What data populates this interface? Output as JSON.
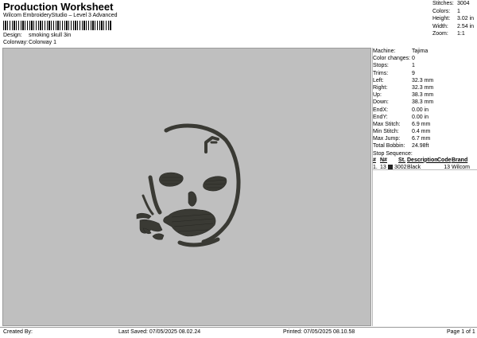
{
  "header": {
    "title": "Production Worksheet",
    "subtitle": "Wilcom EmbroideryStudio – Level 3 Advanced"
  },
  "meta": [
    {
      "key": "Design:",
      "value": "smoking skull 3in"
    },
    {
      "key": "Colorway:",
      "value": "Colorway 1"
    }
  ],
  "stats": [
    {
      "key": "Stitches:",
      "value": "3004"
    },
    {
      "key": "Colors:",
      "value": "1"
    },
    {
      "key": "Height:",
      "value": "3.02 in"
    },
    {
      "key": "Width:",
      "value": "2.54 in"
    },
    {
      "key": "Zoom:",
      "value": "1:1"
    }
  ],
  "info": [
    {
      "key": "Machine:",
      "value": "Tajima"
    },
    {
      "key": "Color changes:",
      "value": "0"
    },
    {
      "key": "Stops:",
      "value": "1"
    },
    {
      "key": "Trims:",
      "value": "9"
    },
    {
      "key": "Left:",
      "value": "32.3 mm"
    },
    {
      "key": "Right:",
      "value": "32.3 mm"
    },
    {
      "key": "Up:",
      "value": "38.3 mm"
    },
    {
      "key": "Down:",
      "value": "38.3 mm"
    },
    {
      "key": "EndX:",
      "value": "0.00 in"
    },
    {
      "key": "EndY:",
      "value": "0.00 in"
    },
    {
      "key": "Max Stitch:",
      "value": "6.9 mm"
    },
    {
      "key": "Min Stitch:",
      "value": "0.4 mm"
    },
    {
      "key": "Max Jump:",
      "value": "6.7 mm"
    },
    {
      "key": "Total Bobbin:",
      "value": "24.98ft"
    }
  ],
  "stop_sequence": {
    "label": "Stop Sequence:",
    "headers": [
      "#",
      "N#",
      "St.",
      "Description",
      "Code",
      "Brand"
    ],
    "rows": [
      {
        "num": "1.",
        "n": "13",
        "st": "3002",
        "desc": "Black",
        "code": "13",
        "brand": "Wilcom",
        "color": "#222222"
      }
    ]
  },
  "footer": {
    "created": "Created By:",
    "saved": "Last Saved: 07/05/2025 08.02.24",
    "printed": "Printed: 07/05/2025 08.10.58",
    "page": "Page 1 of 1"
  },
  "colors": {
    "canvas": "#bfbfbf",
    "thread": "#3a3a34"
  }
}
